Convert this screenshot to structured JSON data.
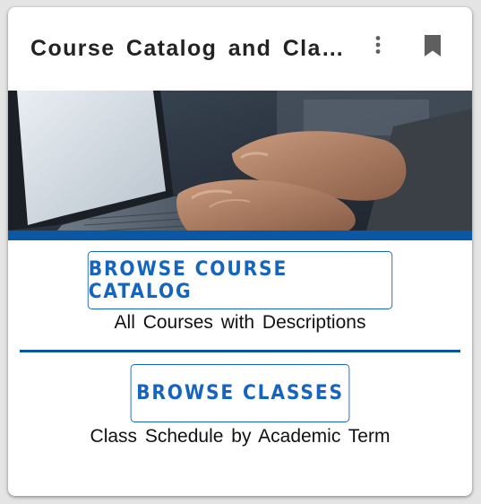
{
  "card": {
    "title": "Course Catalog and Class Schedule",
    "menu_icon": "more-vert-icon",
    "bookmark_icon": "bookmark-icon"
  },
  "hero": {
    "image": "laptop-typing-photo"
  },
  "links": [
    {
      "button_label": "BROWSE COURSE CATALOG",
      "description": "All Courses with Descriptions"
    },
    {
      "button_label": "BROWSE CLASSES",
      "description": "Class Schedule by Academic Term"
    }
  ],
  "colors": {
    "accent": "#1565c0",
    "bar": "#0a57a6",
    "title_text": "#222222",
    "icon": "#5f5f5f"
  }
}
